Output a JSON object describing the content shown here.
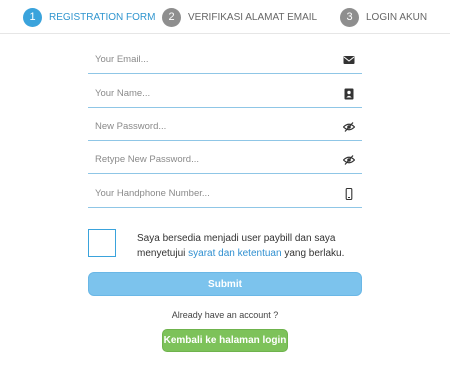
{
  "steps": [
    {
      "number": "1",
      "label": "REGISTRATION FORM",
      "state": "active"
    },
    {
      "number": "2",
      "label": "VERIFIKASI ALAMAT EMAIL",
      "state": "inactive"
    },
    {
      "number": "3",
      "label": "LOGIN AKUN",
      "state": "inactive"
    }
  ],
  "form": {
    "email": {
      "placeholder": "Your Email...",
      "value": "",
      "icon": "envelope-icon"
    },
    "name": {
      "placeholder": "Your Name...",
      "value": "",
      "icon": "id-card-icon"
    },
    "password": {
      "placeholder": "New Password...",
      "value": "",
      "icon": "eye-slash-icon"
    },
    "retype_password": {
      "placeholder": "Retype New Password...",
      "value": "",
      "icon": "eye-slash-icon"
    },
    "phone": {
      "placeholder": "Your Handphone Number...",
      "value": "",
      "icon": "mobile-phone-icon"
    }
  },
  "agreement": {
    "text_before": "Saya bersedia menjadi user paybill dan saya menyetujui ",
    "link_text": "syarat dan ketentuan",
    "text_after": " yang berlaku.",
    "checked": false
  },
  "submit_label": "Submit",
  "already_text": "Already have an account ?",
  "back_label": "Kembali ke halaman login",
  "colors": {
    "accent": "#3aa3dc",
    "inactive_step": "#8e8e8e",
    "submit": "#7cc3ed",
    "back": "#7dc25a",
    "link": "#2f8fd0"
  }
}
